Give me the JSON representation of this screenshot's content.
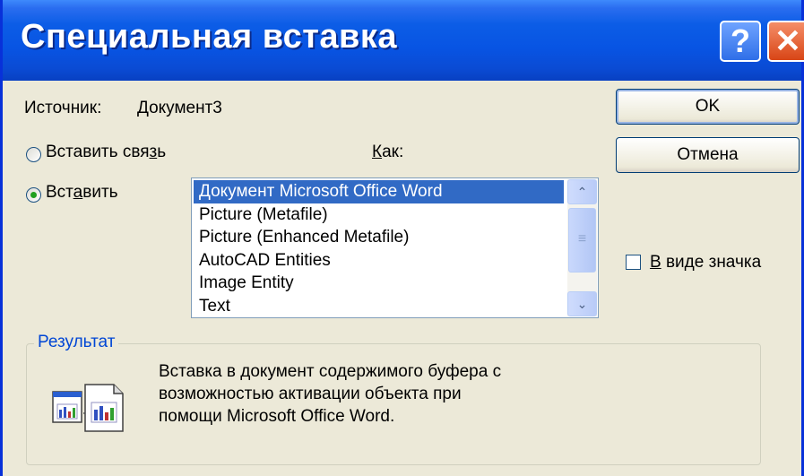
{
  "dialog": {
    "title": "Специальная вставка",
    "help_glyph": "?",
    "close_glyph": "✕"
  },
  "source": {
    "label": "Источник:",
    "value": "Документ3"
  },
  "options": {
    "paste_link": {
      "pre": "Вставить свя",
      "mnemonic": "з",
      "post": "ь",
      "checked": false
    },
    "paste": {
      "pre": "Вст",
      "mnemonic": "а",
      "post": "вить",
      "checked": true
    }
  },
  "as_label": {
    "mnemonic": "К",
    "post": "ак:"
  },
  "listbox": {
    "items": [
      "Документ Microsoft Office Word",
      "Picture (Metafile)",
      "Picture (Enhanced Metafile)",
      "AutoCAD Entities",
      "Image Entity",
      "Text"
    ],
    "selected_index": 0,
    "scroll_up_glyph": "⌃",
    "scroll_down_glyph": "⌄",
    "thumb_grip": "≡"
  },
  "buttons": {
    "ok": "OK",
    "cancel": "Отмена"
  },
  "display_as_icon": {
    "mnemonic": "В",
    "post": " виде значка",
    "checked": false
  },
  "result": {
    "legend": "Результат",
    "lines": [
      "Вставка в документ содержимого буфера с",
      "возможностью активации объекта при",
      "помощи Microsoft Office Word."
    ],
    "icon": "paste-result-icon"
  },
  "colors": {
    "title_bar": "#0854e3",
    "dialog_bg": "#ece9d8",
    "selection": "#316ac5",
    "legend_text": "#0046d5",
    "close_button": "#e05a24",
    "radio_dot": "#21a121"
  }
}
